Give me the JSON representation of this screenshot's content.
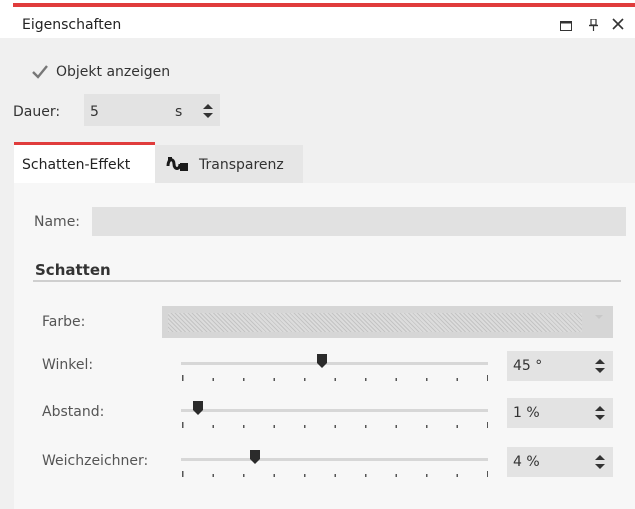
{
  "window": {
    "title": "Eigenschaften",
    "icons": [
      "maximize-icon",
      "pin-icon",
      "close-icon"
    ]
  },
  "options": {
    "show_object_label": "Objekt anzeigen",
    "show_object_checked": true
  },
  "duration": {
    "label": "Dauer:",
    "value": "5",
    "unit": "s"
  },
  "tabs": [
    {
      "label": "Schatten-Effekt",
      "active": true
    },
    {
      "label": "Transparenz",
      "active": false,
      "icon": "transparency-wave-icon"
    }
  ],
  "name_field": {
    "label": "Name:",
    "value": ""
  },
  "section": {
    "title": "Schatten"
  },
  "rows": {
    "farbe": {
      "label": "Farbe:"
    },
    "winkel": {
      "label": "Winkel:",
      "value": "45 °",
      "slider_fraction": 0.46
    },
    "abstand": {
      "label": "Abstand:",
      "value": "1 %",
      "slider_fraction": 0.055
    },
    "weichzeichner": {
      "label": "Weichzeichner:",
      "value": "4 %",
      "slider_fraction": 0.24
    }
  },
  "colors": {
    "accent": "#e03c3c",
    "field_bg": "#e3e3e3",
    "panel_bg": "#f7f7f7"
  }
}
